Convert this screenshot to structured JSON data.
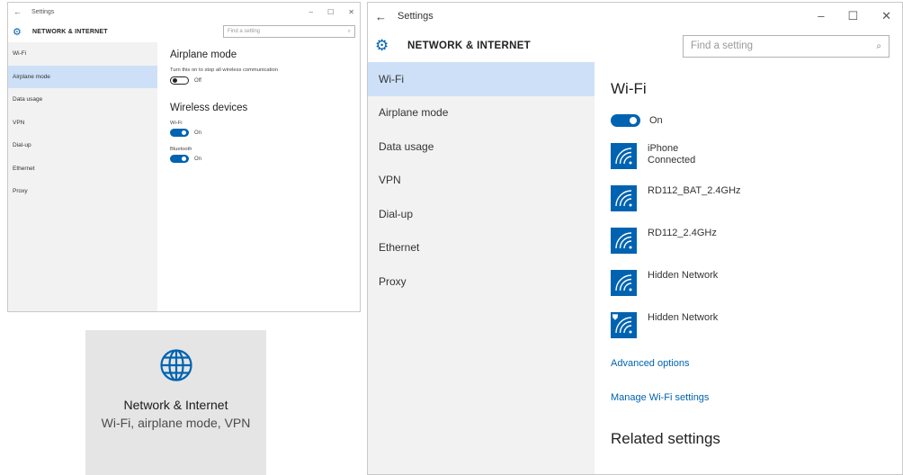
{
  "small_window": {
    "title": "Settings",
    "header_title": "NETWORK & INTERNET",
    "search_placeholder": "Find a setting",
    "sidebar_items": [
      "Wi-Fi",
      "Airplane mode",
      "Data usage",
      "VPN",
      "Dial-up",
      "Ethernet",
      "Proxy"
    ],
    "selected_index": 1,
    "airplane": {
      "heading": "Airplane mode",
      "description": "Turn this on to stop all wireless communication",
      "state": "Off"
    },
    "wireless": {
      "heading": "Wireless devices",
      "wifi_label": "Wi-Fi",
      "wifi_state": "On",
      "bluetooth_label": "Bluetooth",
      "bluetooth_state": "On"
    }
  },
  "tile": {
    "icon": "globe-icon",
    "title": "Network & Internet",
    "subtitle": "Wi-Fi, airplane mode, VPN"
  },
  "large_window": {
    "title": "Settings",
    "header_title": "NETWORK & INTERNET",
    "search_placeholder": "Find a setting",
    "sidebar_items": [
      "Wi-Fi",
      "Airplane mode",
      "Data usage",
      "VPN",
      "Dial-up",
      "Ethernet",
      "Proxy"
    ],
    "selected_index": 0,
    "wifi": {
      "heading": "Wi-Fi",
      "state": "On",
      "networks": [
        {
          "name": "iPhone",
          "status": "Connected",
          "secured": false
        },
        {
          "name": "RD112_BAT_2.4GHz",
          "status": "",
          "secured": false
        },
        {
          "name": "RD112_2.4GHz",
          "status": "",
          "secured": false
        },
        {
          "name": "Hidden Network",
          "status": "",
          "secured": false
        },
        {
          "name": "Hidden Network",
          "status": "",
          "secured": true
        }
      ],
      "advanced_link": "Advanced options",
      "manage_link": "Manage Wi-Fi settings",
      "related_heading": "Related settings"
    }
  },
  "colors": {
    "accent": "#0063b1",
    "selection": "#cde0f7",
    "sidebar_bg": "#f2f2f2",
    "tile_bg": "#e5e5e5"
  }
}
